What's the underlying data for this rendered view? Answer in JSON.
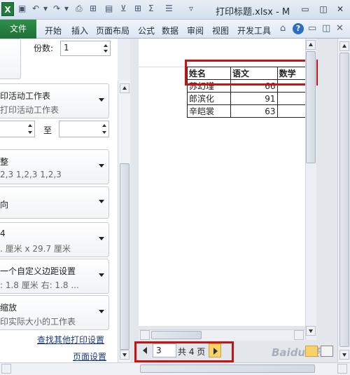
{
  "titlebar": {
    "doc_title": "打印标题.xlsx - M",
    "app_icon": "excel-logo-icon",
    "app_letter": "X",
    "quick_icons": [
      "save-icon",
      "undo-icon",
      "redo-icon",
      "print-preview-icon",
      "borders-icon",
      "freeze-icon",
      "filter-icon",
      "table-icon",
      "sum-icon",
      "align-icon",
      "customize-icon"
    ]
  },
  "ribbon": {
    "tabs": [
      "文件",
      "开始",
      "插入",
      "页面布局",
      "公式",
      "数据",
      "审阅",
      "视图",
      "开发工具"
    ],
    "help": "?"
  },
  "print_settings": {
    "copies_label": "份数:",
    "copies_value": "1",
    "what_title": "印活动工作表",
    "what_sub": "打印活动工作表",
    "pages_to": "至",
    "collate_title": "整",
    "collate_sub": "2,3    1,2,3    1,2,3",
    "orientation_title": "向",
    "paper_title": "4",
    "paper_sub": ". 厘米 x 29.7 厘米",
    "margins_title": "一个自定义边距设置",
    "margins_sub": ":  1.8 厘米    右:  1.8 ...",
    "scaling_title": "缩放",
    "scaling_sub": "印实际大小的工作表",
    "link_more_printers": "查找其他打印设置",
    "link_page_setup": "页面设置"
  },
  "sheet": {
    "headers": [
      "姓名",
      "语文",
      "数学"
    ],
    "rows": [
      [
        "苏幻瑾",
        "66",
        ""
      ],
      [
        "郎滨化",
        "91",
        ""
      ],
      [
        "辛皑裳",
        "63",
        ""
      ]
    ]
  },
  "navigation": {
    "current_page": "3",
    "total_label": "共 4 页"
  },
  "watermark": "Baidu 经验",
  "colors": {
    "highlight": "#cc1111",
    "file_tab": "#1e6f36"
  }
}
